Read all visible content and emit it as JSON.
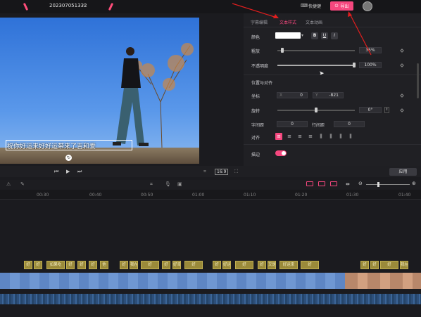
{
  "app": {
    "title": "202307051332",
    "keyboard_label": "快捷键",
    "export_label": "导出"
  },
  "preview": {
    "caption": "祝你好运来好好运带来了吉和爱",
    "ratio": "16:9",
    "apply_label": "应用"
  },
  "panel": {
    "tabs": [
      "字幕编辑",
      "文本样式",
      "文本动画"
    ],
    "active_tab": 1,
    "color_label": "颜色",
    "bold": "B",
    "underline": "U",
    "italic": "I",
    "size_label": "粗放",
    "size_value": "35%",
    "opacity_label": "不透明度",
    "opacity_value": "100%",
    "section_position": "位置与对齐",
    "coord_label": "坐标",
    "x_label": "X",
    "x_value": "0",
    "y_label": "Y",
    "y_value": "-821",
    "rotate_label": "旋转",
    "rotate_value": "0°",
    "char_spacing_label": "字间距",
    "char_spacing_value": "0",
    "line_spacing_label": "行间距",
    "line_spacing_value": "0",
    "align_label": "对齐",
    "stroke_label": "描边"
  },
  "timeline": {
    "ticks": [
      "00:30",
      "00:40",
      "00:50",
      "01:00",
      "01:10",
      "01:20",
      "01:30"
    ],
    "chips": [
      "好",
      "好",
      "如果吃",
      "好",
      "好",
      "好",
      "他",
      "好",
      "我在好",
      "好",
      "好",
      "好幸运",
      "好",
      "好",
      "好运来",
      "好",
      "好",
      "又是好",
      "好运来",
      "好",
      "好",
      "好",
      "好",
      "我在好"
    ]
  },
  "colors": {
    "accent": "#f5477e",
    "panel_bg": "#202024",
    "chip_bg": "#9a8a3a"
  }
}
